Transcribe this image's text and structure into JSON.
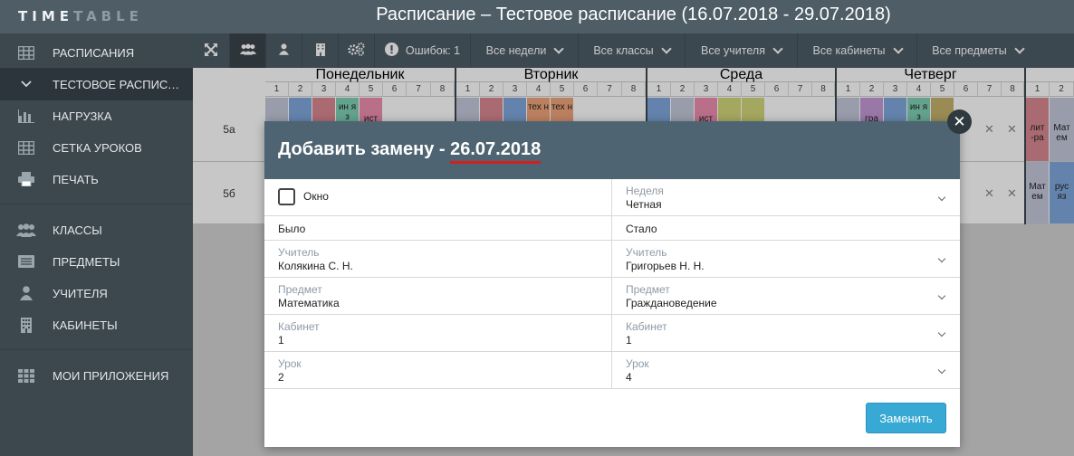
{
  "logo": {
    "part1": "TIME",
    "part2": "TABLE"
  },
  "header": {
    "title": "Расписание – Тестовое расписание (16.07.2018 - 29.07.2018)"
  },
  "sidebar": {
    "items": [
      {
        "label": "РАСПИСАНИЯ",
        "icon": "table-icon"
      },
      {
        "label": "ТЕСТОВОЕ РАСПИСАНИЕ",
        "icon": "chevron-down-icon"
      },
      {
        "label": "НАГРУЗКА",
        "icon": "bar-chart-icon"
      },
      {
        "label": "СЕТКА УРОКОВ",
        "icon": "grid-icon"
      },
      {
        "label": "ПЕЧАТЬ",
        "icon": "printer-icon"
      },
      {
        "label": "КЛАССЫ",
        "icon": "group-icon"
      },
      {
        "label": "ПРЕДМЕТЫ",
        "icon": "list-icon"
      },
      {
        "label": "УЧИТЕЛЯ",
        "icon": "user-icon"
      },
      {
        "label": "КАБИНЕТЫ",
        "icon": "building-icon"
      },
      {
        "label": "МОИ ПРИЛОЖЕНИЯ",
        "icon": "apps-icon"
      }
    ]
  },
  "toolbar": {
    "errors_label": "Ошибок: 1",
    "filters": [
      "Все недели",
      "Все классы",
      "Все учителя",
      "Все кабинеты",
      "Все предметы"
    ]
  },
  "grid": {
    "days": [
      "Понедельник",
      "Вторник",
      "Среда",
      "Четверг"
    ],
    "lessons": [
      "1",
      "2",
      "3",
      "4",
      "5",
      "6",
      "7",
      "8"
    ],
    "classes": [
      "5а",
      "5б"
    ],
    "cells": {
      "mon4": "ин я з",
      "mon5": "ист",
      "tue4": "тех н",
      "tue5": "тех н",
      "wed3": "ист",
      "thu2": "гра",
      "thu4": "ин я з",
      "lit": "лит -ра",
      "mat1": "Мат ем",
      "mat2": "Мат ем",
      "rus": "рус яз"
    }
  },
  "modal": {
    "title_prefix": "Добавить замену -",
    "title_date": "26.07.2018",
    "window_label": "Окно",
    "week_label": "Неделя",
    "week_value": "Четная",
    "was_label": "Было",
    "became_label": "Стало",
    "teacher_label": "Учитель",
    "teacher_was": "Колякина С. Н.",
    "teacher_new": "Григорьев Н. Н.",
    "subject_label": "Предмет",
    "subject_was": "Математика",
    "subject_new": "Граждановедение",
    "room_label": "Кабинет",
    "room_was": "1",
    "room_new": "1",
    "lesson_label": "Урок",
    "lesson_was": "2",
    "lesson_new": "4",
    "submit_label": "Заменить"
  },
  "colors": {
    "header_bg": "#4e5d66",
    "sidebar_bg": "#3c474e",
    "modal_head_bg": "#4e6472",
    "accent_underline": "#d41f1f",
    "submit_bg": "#37a9d4"
  }
}
